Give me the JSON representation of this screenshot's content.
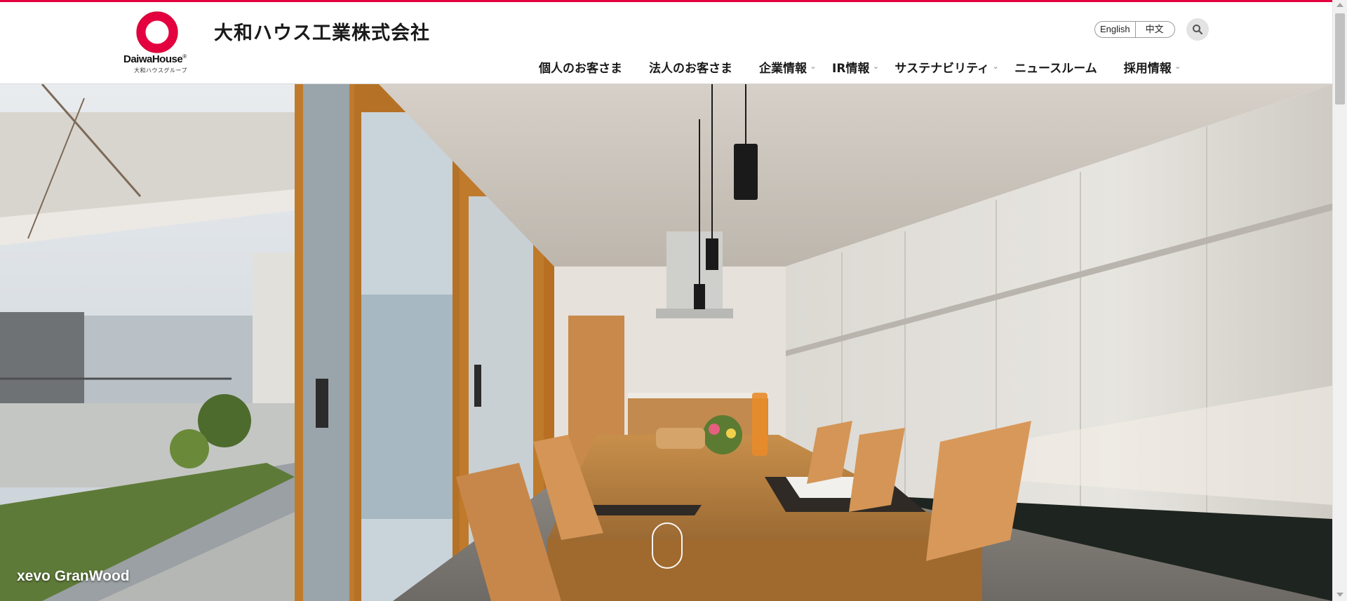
{
  "brand": {
    "logo_main": "DaiwaHouse",
    "logo_reg": "®",
    "logo_sub": "大和ハウスグループ",
    "company_name": "大和ハウス工業株式会社",
    "accent_color": "#e4003f"
  },
  "header": {
    "lang": {
      "english": "English",
      "chinese": "中文"
    },
    "search_icon": "search-icon"
  },
  "nav": {
    "items": [
      {
        "label": "個人のお客さま",
        "has_submenu": false
      },
      {
        "label": "法人のお客さま",
        "has_submenu": false
      },
      {
        "label": "企業情報",
        "has_submenu": true
      },
      {
        "label": "IR情報",
        "has_submenu": true
      },
      {
        "label": "サステナビリティ",
        "has_submenu": true
      },
      {
        "label": "ニュースルーム",
        "has_submenu": false
      },
      {
        "label": "採用情報",
        "has_submenu": true
      }
    ]
  },
  "hero": {
    "caption": "xevo GranWood"
  }
}
